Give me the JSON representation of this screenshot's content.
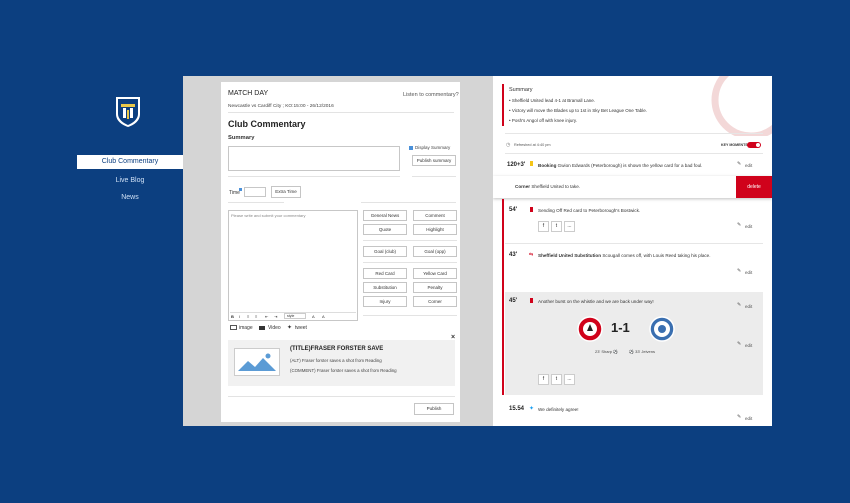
{
  "sidebar": {
    "nav": [
      {
        "label": "Club Commentary",
        "active": true
      },
      {
        "label": "Live Blog",
        "active": false
      },
      {
        "label": "News",
        "active": false
      }
    ]
  },
  "editor": {
    "header_title": "MATCH DAY",
    "listen_link": "Listen to commentary?",
    "fixture": "Newcastle vs Cardiff City ; KO:15:00 - 26/12/2016",
    "title": "Club Commentary",
    "summary_label": "Summary",
    "display_summary_label": "Display Summary",
    "publish_summary_button": "Publish summary",
    "time_label": "Time",
    "extra_time_button": "Extra Time",
    "commentary_placeholder": "Please write and submit your commentary",
    "toolbar_style_value": "style",
    "quick_buttons": [
      "General News",
      "Comment",
      "Quote",
      "Highlight",
      "Goal (club)",
      "Goal (opp)",
      "Red Card",
      "Yellow Card",
      "Substitution",
      "Penalty",
      "Injury",
      "Corner"
    ],
    "media": {
      "image": "image",
      "video": "Video",
      "tweet": "tweet"
    },
    "card": {
      "title": "(TITLE)FRASER FORSTER SAVE",
      "alt": "(ALT) Fraser forster saves a shot from Reading",
      "comment": "(COMMENT) Fraser forster saves a shot from Reading"
    },
    "publish_button": "Publish"
  },
  "preview": {
    "summary_title": "Summary",
    "summary_items": [
      "Sheffield United lead 4-1 at Bramall Lane.",
      "Victory will move the Blades up to 1st in Sky Bet League One Table.",
      "Posh's Angol off with knee injury."
    ],
    "refreshed": "Refreshed at 4:40 pm",
    "key_moments": "KEY MOMENTS",
    "edit_label": "edit",
    "delete_label": "delete",
    "entries": [
      {
        "time": "120+3'",
        "tag": "Booking",
        "text": "Gwion Edwards (Peterborough) is shown the yellow card for a bad foul."
      },
      {
        "time": "",
        "tag": "Corner",
        "text": "Sheffield United to take."
      },
      {
        "time": "54'",
        "tag": "",
        "text": "Sending Off Red card to Peterborough's Bostwick."
      },
      {
        "time": "43'",
        "tag": "Sheffield United Substitution",
        "text": "Scougall comes off, with Louis Reed taking his place."
      },
      {
        "time": "45'",
        "tag": "",
        "text": "Another burst on the whistle and we are back under way!"
      },
      {
        "time": "15.54",
        "tag": "",
        "text": "We definitely agree!"
      }
    ],
    "score": "1-1",
    "shots_home": "23' Sharp",
    "shots_away": "33' Jeivens",
    "share": {
      "facebook": "f",
      "twitter": "t",
      "more": "..."
    }
  },
  "colors": {
    "brand_blue": "#0c3f80",
    "accent_red": "#d0021b"
  }
}
